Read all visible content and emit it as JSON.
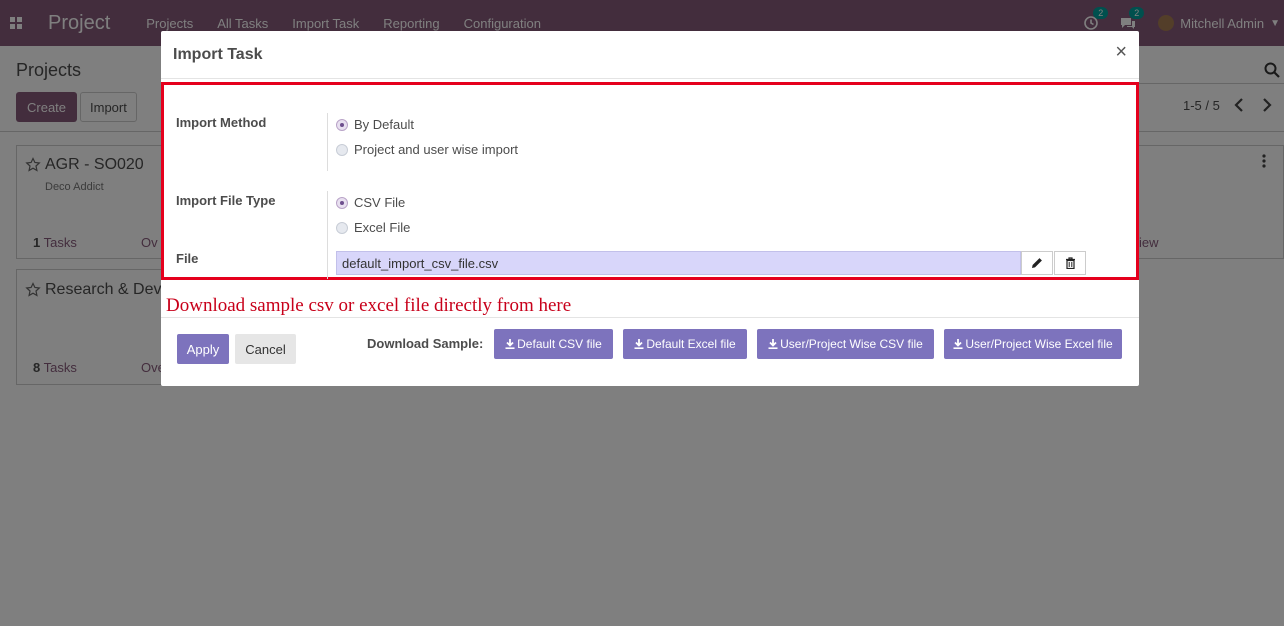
{
  "navbar": {
    "app_title": "Project",
    "menu": [
      "Projects",
      "All Tasks",
      "Import Task",
      "Reporting",
      "Configuration"
    ],
    "activity_badge": "2",
    "messages_badge": "2",
    "user_name": "Mitchell Admin",
    "color": "#875a7b"
  },
  "control_panel": {
    "breadcrumb": "Projects",
    "create_label": "Create",
    "import_label": "Import",
    "pager": "1-5 / 5"
  },
  "kanban": {
    "cards": [
      {
        "title": "AGR - SO020",
        "subtitle": "Deco Addict",
        "task_count": "1",
        "task_label": "Tasks",
        "overview_partial": "Ov",
        "right_partial": "iew"
      },
      {
        "title": "Research & Dev",
        "task_count": "8",
        "task_label": "Tasks",
        "overview_partial": "Ove"
      }
    ]
  },
  "modal": {
    "title": "Import Task",
    "close_symbol": "×",
    "import_method": {
      "label": "Import Method",
      "options": [
        "By Default",
        "Project and user wise import"
      ],
      "selected": "By Default"
    },
    "import_file_type": {
      "label": "Import File Type",
      "options": [
        "CSV File",
        "Excel File"
      ],
      "selected": "CSV File"
    },
    "file": {
      "label": "File",
      "value": "default_import_csv_file.csv"
    },
    "annotation": "Download sample csv or excel file directly from here",
    "apply_label": "Apply",
    "cancel_label": "Cancel",
    "download_sample_label": "Download Sample:",
    "download_buttons": [
      "Default CSV file",
      "Default Excel file",
      "User/Project Wise CSV file",
      "User/Project Wise Excel file"
    ],
    "accent_color": "#7d73bd",
    "highlight_color": "#e5001d"
  }
}
